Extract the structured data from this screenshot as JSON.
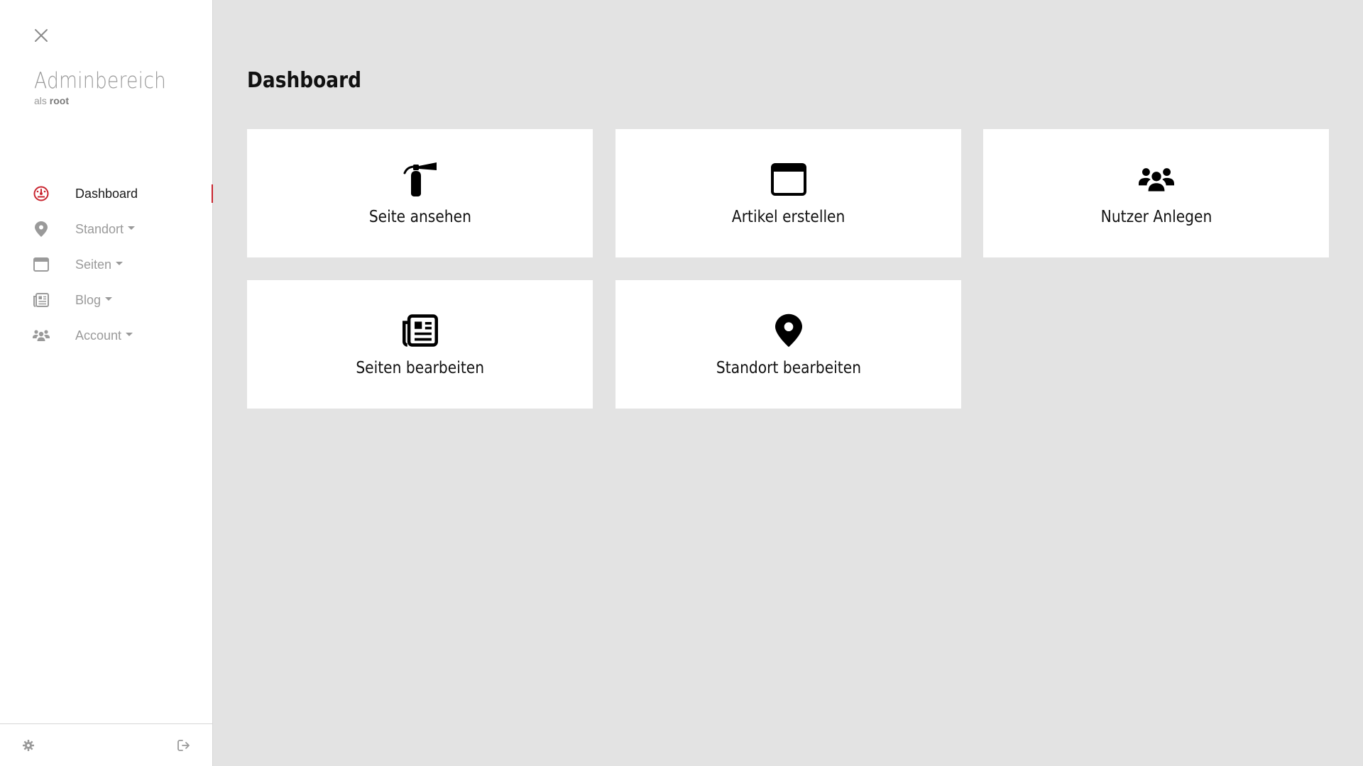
{
  "sidebar": {
    "brand": {
      "title": "Adminbereich",
      "prefix": "als",
      "user": "root"
    },
    "items": [
      {
        "label": "Dashboard",
        "icon": "dashboard-gauge-icon",
        "active": true,
        "has_dropdown": false
      },
      {
        "label": "Standort",
        "icon": "map-marker-icon",
        "active": false,
        "has_dropdown": true
      },
      {
        "label": "Seiten",
        "icon": "browser-window-icon",
        "active": false,
        "has_dropdown": true
      },
      {
        "label": "Blog",
        "icon": "newspaper-icon",
        "active": false,
        "has_dropdown": true
      },
      {
        "label": "Account",
        "icon": "users-icon",
        "active": false,
        "has_dropdown": true
      }
    ],
    "footer": {
      "settings_icon": "gear-icon",
      "logout_icon": "sign-out-icon"
    }
  },
  "main": {
    "title": "Dashboard",
    "cards": [
      {
        "label": "Seite ansehen",
        "icon": "fire-extinguisher-icon"
      },
      {
        "label": "Artikel erstellen",
        "icon": "browser-window-icon"
      },
      {
        "label": "Nutzer Anlegen",
        "icon": "users-icon"
      },
      {
        "label": "Seiten bearbeiten",
        "icon": "newspaper-icon"
      },
      {
        "label": "Standort bearbeiten",
        "icon": "map-marker-icon"
      }
    ]
  },
  "colors": {
    "accent": "#c9242f",
    "sidebar_bg": "#ffffff",
    "main_bg": "#e3e3e3",
    "muted_text": "#9a9a9a",
    "text": "#111111"
  }
}
